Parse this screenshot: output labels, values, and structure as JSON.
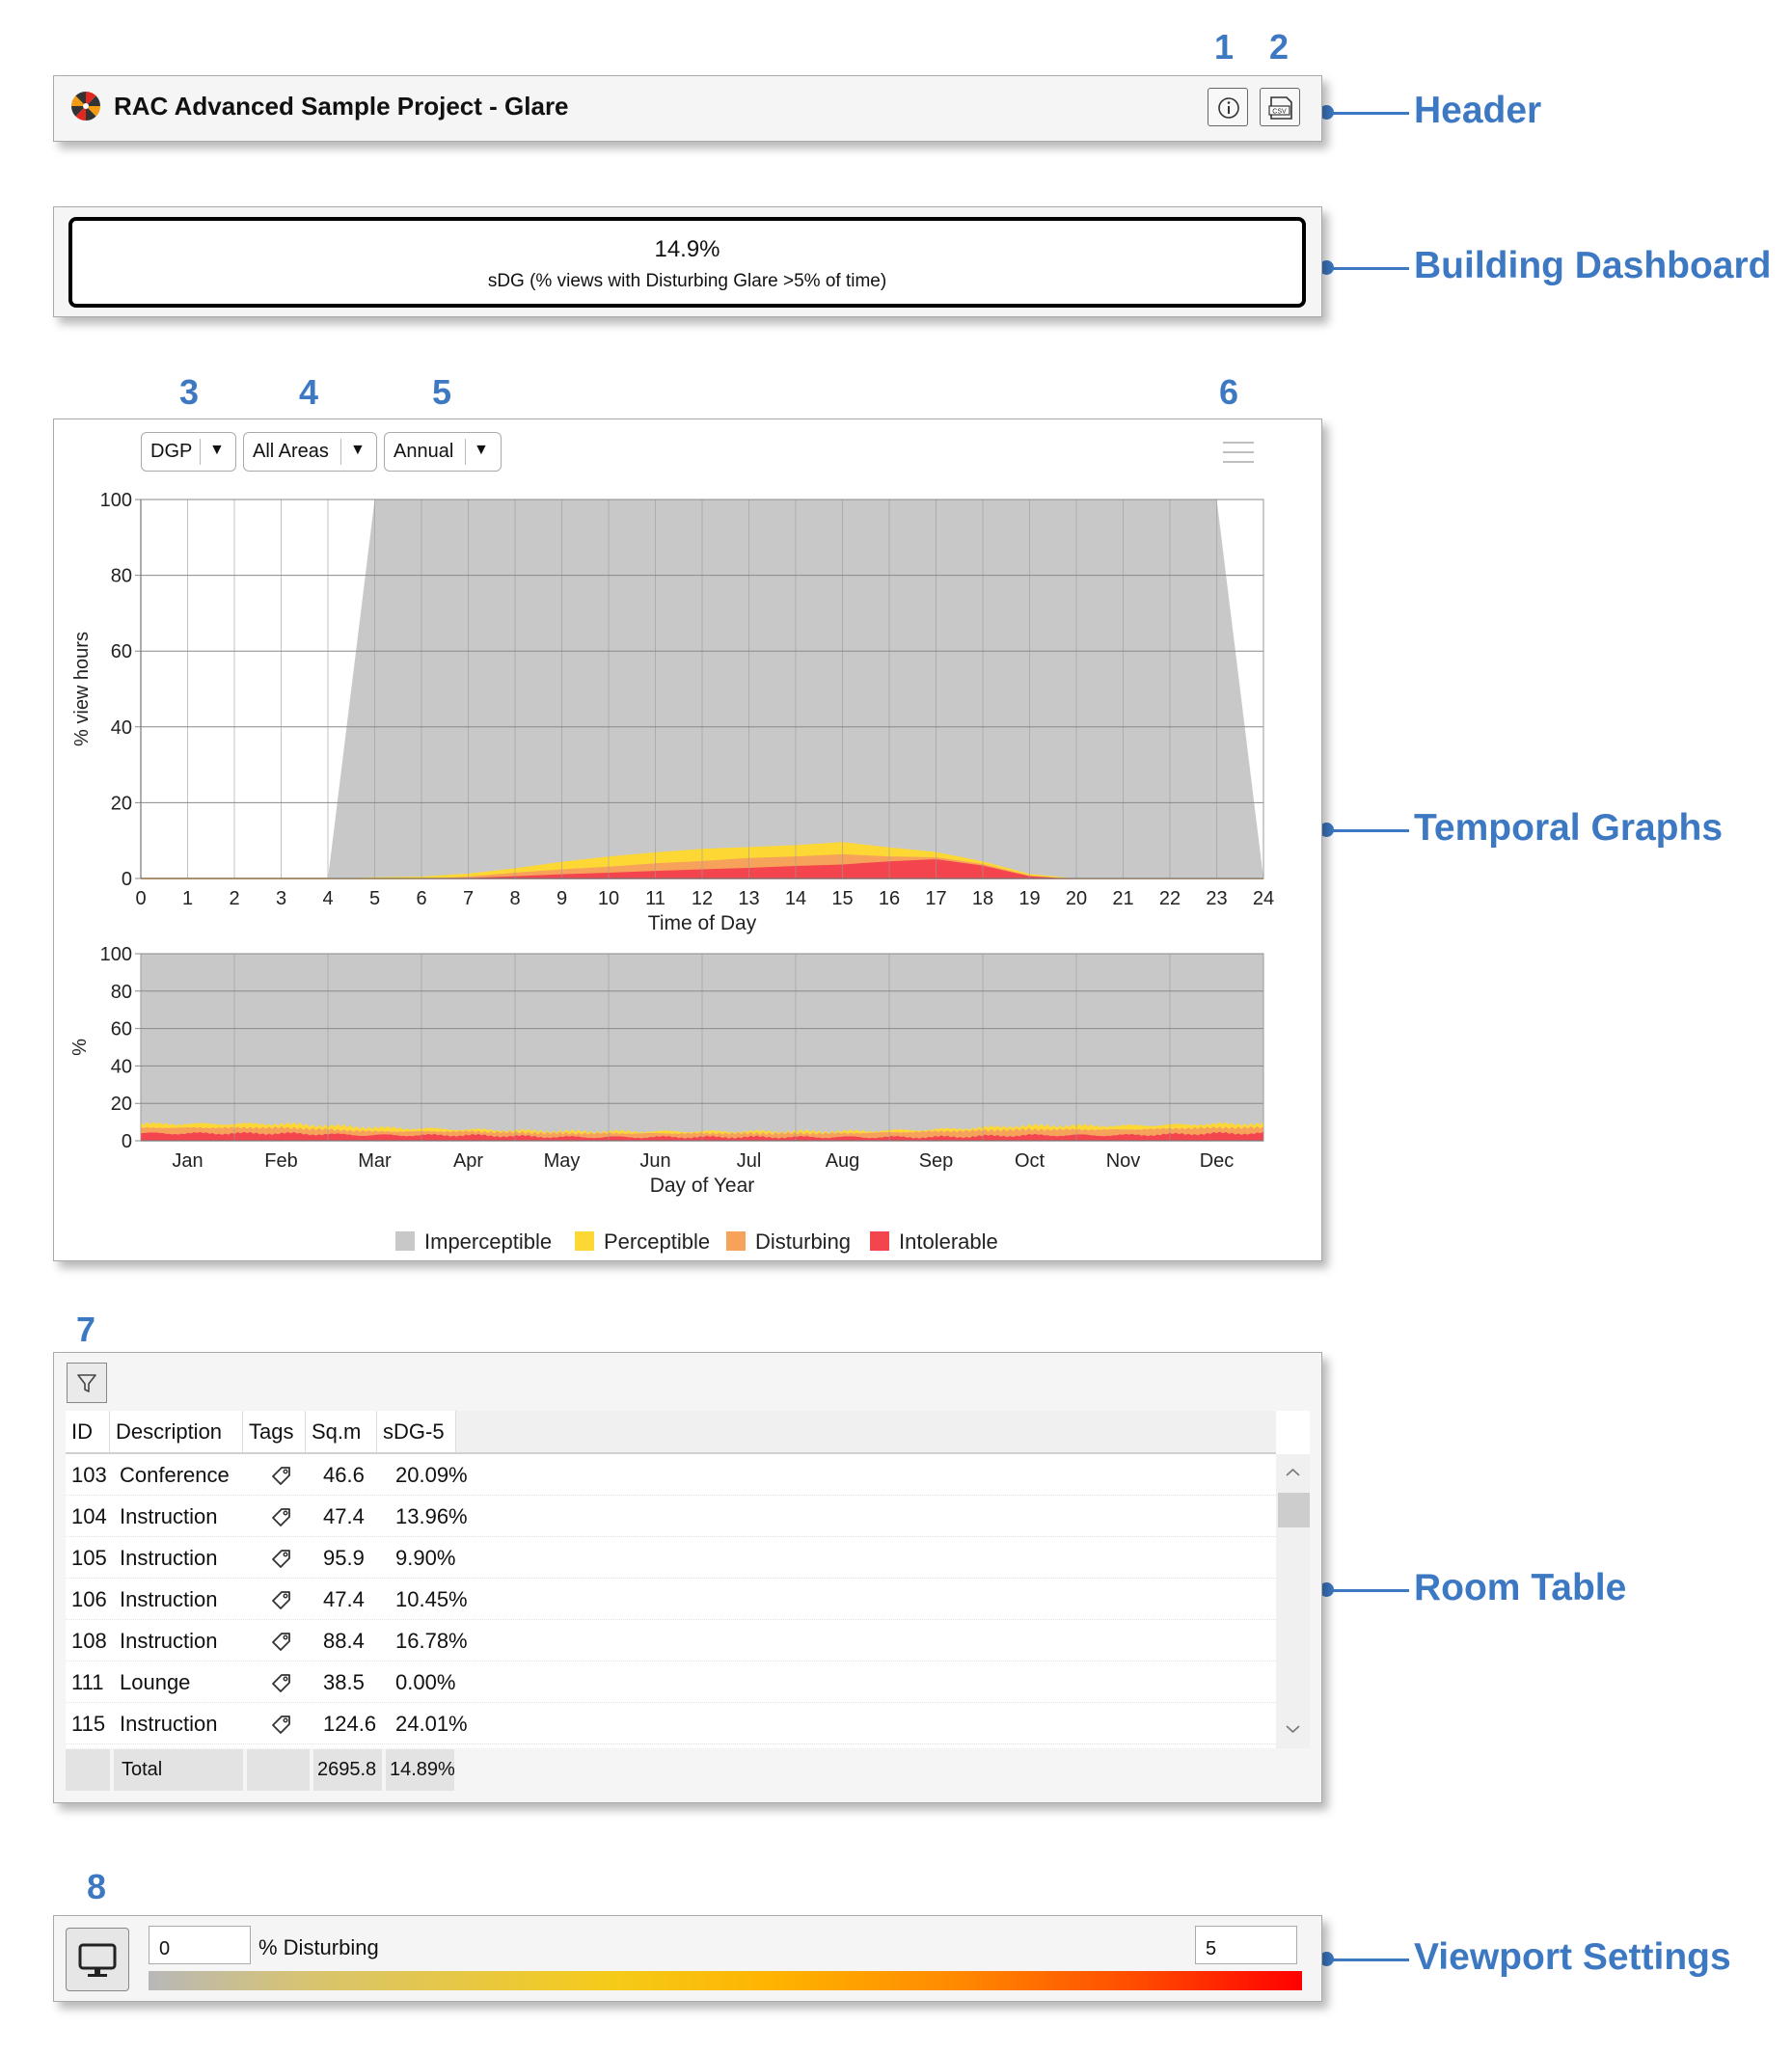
{
  "annotations": {
    "numbers": [
      "1",
      "2",
      "3",
      "4",
      "5",
      "6",
      "7",
      "8"
    ],
    "labels": {
      "header": "Header",
      "dashboard": "Building Dashboard",
      "temporal": "Temporal Graphs",
      "room_table": "Room Table",
      "viewport": "Viewport Settings"
    },
    "color": "#3d78c2"
  },
  "header": {
    "title": "RAC Advanced Sample Project - Glare",
    "buttons": [
      {
        "icon": "info-icon"
      },
      {
        "icon": "csv-export-icon",
        "label": "CSV"
      }
    ]
  },
  "dashboard": {
    "value": "14.9%",
    "label": "sDG (% views with Disturbing Glare >5% of time)"
  },
  "graph_controls": {
    "metric": "DGP",
    "area": "All Areas",
    "period": "Annual",
    "menu_icon": "hamburger-menu-icon"
  },
  "chart_data": [
    {
      "type": "area",
      "stacked": true,
      "xlabel": "Time of Day",
      "ylabel": "% view hours",
      "xlim": [
        0,
        24
      ],
      "ylim": [
        0,
        100
      ],
      "xticks": [
        "0",
        "1",
        "2",
        "3",
        "4",
        "5",
        "6",
        "7",
        "8",
        "9",
        "10",
        "11",
        "12",
        "13",
        "14",
        "15",
        "16",
        "17",
        "18",
        "19",
        "20",
        "21",
        "22",
        "23",
        "24"
      ],
      "yticks": [
        "0",
        "20",
        "40",
        "60",
        "80",
        "100"
      ],
      "grid": true,
      "x": [
        0,
        1,
        2,
        3,
        4,
        5,
        6,
        7,
        8,
        9,
        10,
        11,
        12,
        13,
        14,
        15,
        16,
        17,
        18,
        19,
        20,
        21,
        22,
        23,
        24
      ],
      "series": [
        {
          "name": "Intolerable",
          "color": "#f4444e",
          "values": [
            0,
            0,
            0,
            0,
            0,
            0,
            0,
            0.3,
            0.8,
            1.3,
            1.7,
            2.2,
            2.6,
            3.0,
            3.5,
            3.9,
            4.7,
            5.3,
            3.6,
            0.8,
            0,
            0,
            0,
            0,
            0
          ]
        },
        {
          "name": "Disturbing",
          "color": "#f7a25a",
          "values": [
            0,
            0,
            0,
            0,
            0,
            0,
            0,
            0.4,
            0.9,
            1.3,
            1.6,
            2.0,
            2.2,
            2.6,
            2.5,
            2.7,
            1.3,
            0.5,
            0.4,
            0.2,
            0,
            0,
            0,
            0,
            0
          ]
        },
        {
          "name": "Perceptible",
          "color": "#fdd835",
          "values": [
            0,
            0,
            0,
            0,
            0,
            0.3,
            0.5,
            0.6,
            1.0,
            1.8,
            2.5,
            2.7,
            3.0,
            2.7,
            2.8,
            3.0,
            2.2,
            1.2,
            0.5,
            0.2,
            0,
            0,
            0,
            0,
            0
          ]
        },
        {
          "name": "Imperceptible",
          "color": "#c8c8c8",
          "values": [
            0,
            0,
            0,
            0,
            0,
            99.7,
            99.5,
            98.7,
            97.3,
            95.6,
            94.2,
            93.1,
            92.2,
            91.7,
            91.2,
            90.4,
            91.8,
            93.0,
            95.5,
            98.8,
            100,
            100,
            100,
            100,
            0
          ]
        }
      ]
    },
    {
      "type": "area",
      "stacked": true,
      "xlabel": "Day of Year",
      "ylabel": "%",
      "ylim": [
        0,
        100
      ],
      "yticks": [
        "0",
        "20",
        "40",
        "60",
        "80",
        "100"
      ],
      "categories": [
        "Jan",
        "Feb",
        "Mar",
        "Apr",
        "May",
        "Jun",
        "Jul",
        "Aug",
        "Sep",
        "Oct",
        "Nov",
        "Dec"
      ],
      "grid": true,
      "series": [
        {
          "name": "Intolerable",
          "color": "#f4444e",
          "values": [
            4,
            4,
            3,
            3,
            2,
            2,
            2,
            2,
            2,
            3,
            3,
            4
          ]
        },
        {
          "name": "Disturbing",
          "color": "#f7a25a",
          "values": [
            3,
            3,
            2,
            2,
            2,
            2,
            2,
            2,
            3,
            3,
            3,
            3
          ]
        },
        {
          "name": "Perceptible",
          "color": "#fdd835",
          "values": [
            2,
            2,
            2,
            1,
            1,
            1,
            1,
            1,
            1,
            2,
            2,
            2
          ]
        },
        {
          "name": "Imperceptible",
          "color": "#c8c8c8",
          "values": [
            91,
            91,
            93,
            94,
            95,
            95,
            95,
            95,
            94,
            92,
            92,
            91
          ]
        }
      ]
    }
  ],
  "legend": [
    {
      "label": "Imperceptible",
      "color": "#c8c8c8"
    },
    {
      "label": "Perceptible",
      "color": "#fdd835"
    },
    {
      "label": "Disturbing",
      "color": "#f7a25a"
    },
    {
      "label": "Intolerable",
      "color": "#f4444e"
    }
  ],
  "room_table": {
    "filter_icon": "filter-icon",
    "columns": [
      "ID",
      "Description",
      "Tags",
      "Sq.m",
      "sDG-5"
    ],
    "rows": [
      {
        "id": "103",
        "description": "Conference",
        "sqm": "46.6",
        "sdg": "20.09%"
      },
      {
        "id": "104",
        "description": "Instruction",
        "sqm": "47.4",
        "sdg": "13.96%"
      },
      {
        "id": "105",
        "description": "Instruction",
        "sqm": "95.9",
        "sdg": "9.90%"
      },
      {
        "id": "106",
        "description": "Instruction",
        "sqm": "47.4",
        "sdg": "10.45%"
      },
      {
        "id": "108",
        "description": "Instruction",
        "sqm": "88.4",
        "sdg": "16.78%"
      },
      {
        "id": "111",
        "description": "Lounge",
        "sqm": "38.5",
        "sdg": "0.00%"
      },
      {
        "id": "115",
        "description": "Instruction",
        "sqm": "124.6",
        "sdg": "24.01%"
      }
    ],
    "total": {
      "label": "Total",
      "sqm": "2695.8",
      "sdg": "14.89%"
    }
  },
  "viewport": {
    "toggle_icon": "monitor-icon",
    "min": "0",
    "max": "5",
    "label": "% Disturbing"
  }
}
